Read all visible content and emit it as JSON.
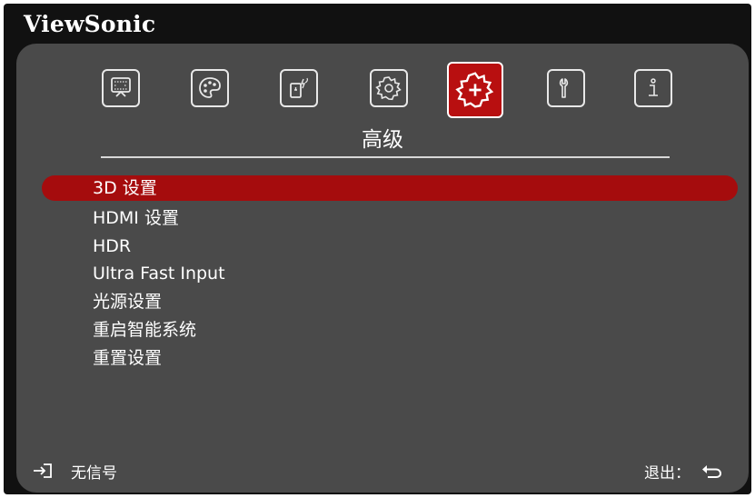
{
  "brand": "ViewSonic",
  "tabs": [
    {
      "icon": "display-icon"
    },
    {
      "icon": "palette-icon"
    },
    {
      "icon": "power-management-icon"
    },
    {
      "icon": "settings-gear-icon"
    },
    {
      "icon": "advanced-gear-icon",
      "active": true
    },
    {
      "icon": "wrench-icon"
    },
    {
      "icon": "info-icon"
    }
  ],
  "category_title": "高级",
  "menu": {
    "items": [
      {
        "label": "3D 设置",
        "selected": true
      },
      {
        "label": "HDMI 设置"
      },
      {
        "label": "HDR"
      },
      {
        "label": "Ultra Fast Input"
      },
      {
        "label": "光源设置"
      },
      {
        "label": "重启智能系统"
      },
      {
        "label": "重置设置"
      }
    ]
  },
  "footer": {
    "input_status": "无信号",
    "exit_label": "退出："
  },
  "colors": {
    "panel": "#4a4a4a",
    "highlight": "#a50c0d",
    "active_tab": "#b80f10",
    "frame": "#111111"
  }
}
